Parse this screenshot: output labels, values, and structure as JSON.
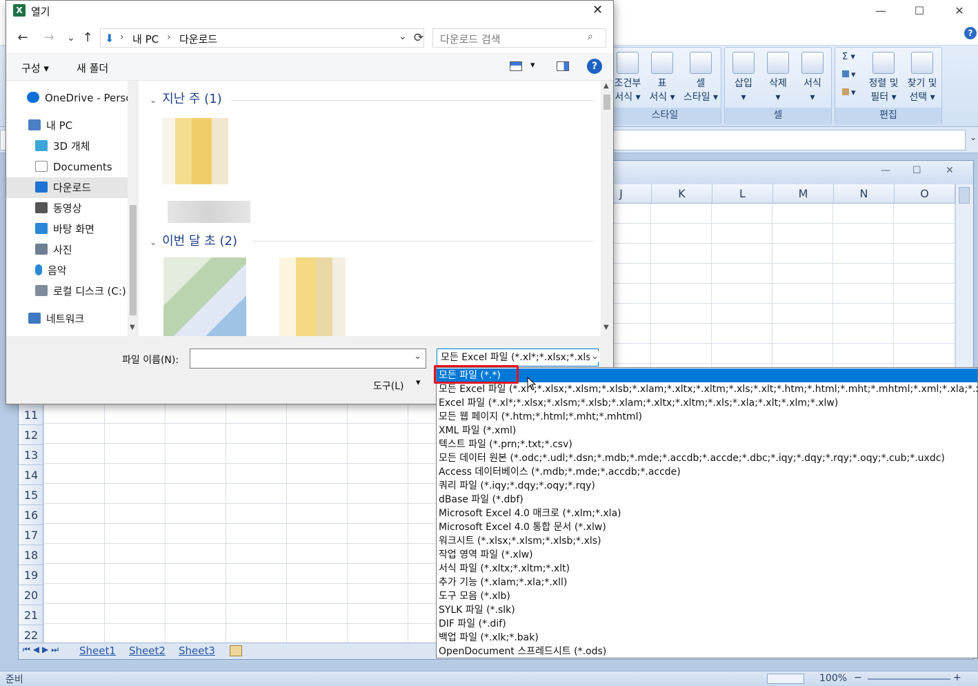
{
  "excel": {
    "window_controls": {
      "minimize": "—",
      "maximize": "☐",
      "close": "✕"
    },
    "ribbon": {
      "styles_group": {
        "label": "스타일",
        "buttons": [
          {
            "line1": "조건부",
            "line2": "서식 ▾"
          },
          {
            "line1": "표",
            "line2": "서식 ▾"
          },
          {
            "line1": "셀",
            "line2": "스타일 ▾"
          }
        ]
      },
      "cells_group": {
        "label": "셀",
        "buttons": [
          {
            "line1": "삽입",
            "line2": "▾"
          },
          {
            "line1": "삭제",
            "line2": "▾"
          },
          {
            "line1": "서식",
            "line2": "▾"
          }
        ]
      },
      "edit_group": {
        "label": "편집",
        "small": [
          "Σ ▾",
          "▾",
          "▾"
        ],
        "buttons": [
          {
            "line1": "정렬 및",
            "line2": "필터 ▾"
          },
          {
            "line1": "찾기 및",
            "line2": "선택 ▾"
          }
        ]
      },
      "help_icon": "?"
    },
    "columns": [
      "J",
      "K",
      "L",
      "M",
      "N",
      "O"
    ],
    "rows": [
      "11",
      "12",
      "13",
      "14",
      "15",
      "16",
      "17",
      "18",
      "19",
      "20",
      "21",
      "22"
    ],
    "sheet_tabs": [
      "Sheet1",
      "Sheet2",
      "Sheet3"
    ],
    "status": {
      "ready": "준비",
      "zoom": "100%",
      "minus": "−",
      "plus": "+"
    }
  },
  "dialog": {
    "title": "열기",
    "close": "✕",
    "nav": {
      "back": "←",
      "forward": "→",
      "recent": "⌄",
      "up": "↑",
      "refresh": "⟳"
    },
    "breadcrumb": {
      "sep": "›",
      "items": [
        "내 PC",
        "다운로드"
      ]
    },
    "search_placeholder": "다운로드 검색",
    "commands": {
      "organize": "구성 ▾",
      "new_folder": "새 폴더",
      "view_arrow": "▾",
      "help": "?"
    },
    "nav_pane": [
      {
        "label": "OneDrive - Personal",
        "color": "#0a6fd6"
      },
      {
        "label": "내 PC",
        "color": "#4a7fc1"
      },
      {
        "label": "3D 개체",
        "color": "#3aa7d8"
      },
      {
        "label": "Documents",
        "color": "#8a8a8a"
      },
      {
        "label": "다운로드",
        "color": "#1f73d2"
      },
      {
        "label": "동영상",
        "color": "#555"
      },
      {
        "label": "바탕 화면",
        "color": "#2b88d8"
      },
      {
        "label": "사진",
        "color": "#6e7f91"
      },
      {
        "label": "음악",
        "color": "#2b88d8"
      },
      {
        "label": "로컬 디스크 (C:)",
        "color": "#7f8c99"
      },
      {
        "label": "네트워크",
        "color": "#3f79c0"
      }
    ],
    "groups": [
      {
        "label": "지난 주 (1)"
      },
      {
        "label": "이번 달 초 (2)"
      }
    ],
    "filename_label": "파일 이름(N):",
    "filename_value": "",
    "filetype_value": "모든 Excel 파일 (*.xl*;*.xlsx;*.xlsm;*.xlsb;*.xlam;*.xltx;*.xltm;*.xls;*.xlt;*.htm;*.html;*.mht;*.mhtml;*.xml;*.xla;*.xlm;*.xlw;*.odc;*.ods)",
    "tools_label": "도구(L)",
    "tools_arrow": "▾",
    "filetype_options": [
      "모든 파일 (*.*)",
      "모든 Excel 파일 (*.xl*;*.xlsx;*.xlsm;*.xlsb;*.xlam;*.xltx;*.xltm;*.xls;*.xlt;*.htm;*.html;*.mht;*.mhtml;*.xml;*.xla;*.xlm;*.xlw;*.odc",
      "Excel 파일 (*.xl*;*.xlsx;*.xlsm;*.xlsb;*.xlam;*.xltx;*.xltm;*.xls;*.xla;*.xlt;*.xlm;*.xlw)",
      "모든 웹 페이지 (*.htm;*.html;*.mht;*.mhtml)",
      "XML 파일 (*.xml)",
      "텍스트 파일 (*.prn;*.txt;*.csv)",
      "모든 데이터 원본 (*.odc;*.udl;*.dsn;*.mdb;*.mde;*.accdb;*.accde;*.dbc;*.iqy;*.dqy;*.rqy;*.oqy;*.cub;*.uxdc)",
      "Access 데이터베이스 (*.mdb;*.mde;*.accdb;*.accde)",
      "쿼리 파일 (*.iqy;*.dqy;*.oqy;*.rqy)",
      "dBase 파일 (*.dbf)",
      "Microsoft Excel 4.0 매크로 (*.xlm;*.xla)",
      "Microsoft Excel 4.0 통합 문서 (*.xlw)",
      "워크시트 (*.xlsx;*.xlsm;*.xlsb;*.xls)",
      "작업 영역 파일 (*.xlw)",
      "서식 파일 (*.xltx;*.xltm;*.xlt)",
      "추가 기능 (*.xlam;*.xla;*.xll)",
      "도구 모음 (*.xlb)",
      "SYLK 파일 (*.slk)",
      "DIF 파일 (*.dif)",
      "백업 파일 (*.xlk;*.bak)",
      "OpenDocument 스프레드시트 (*.ods)"
    ],
    "selected_option_index": 0
  },
  "colors": {
    "accent": "#0078d7",
    "highlight_border": "#e0141e",
    "group_header": "#1e3f8a"
  }
}
